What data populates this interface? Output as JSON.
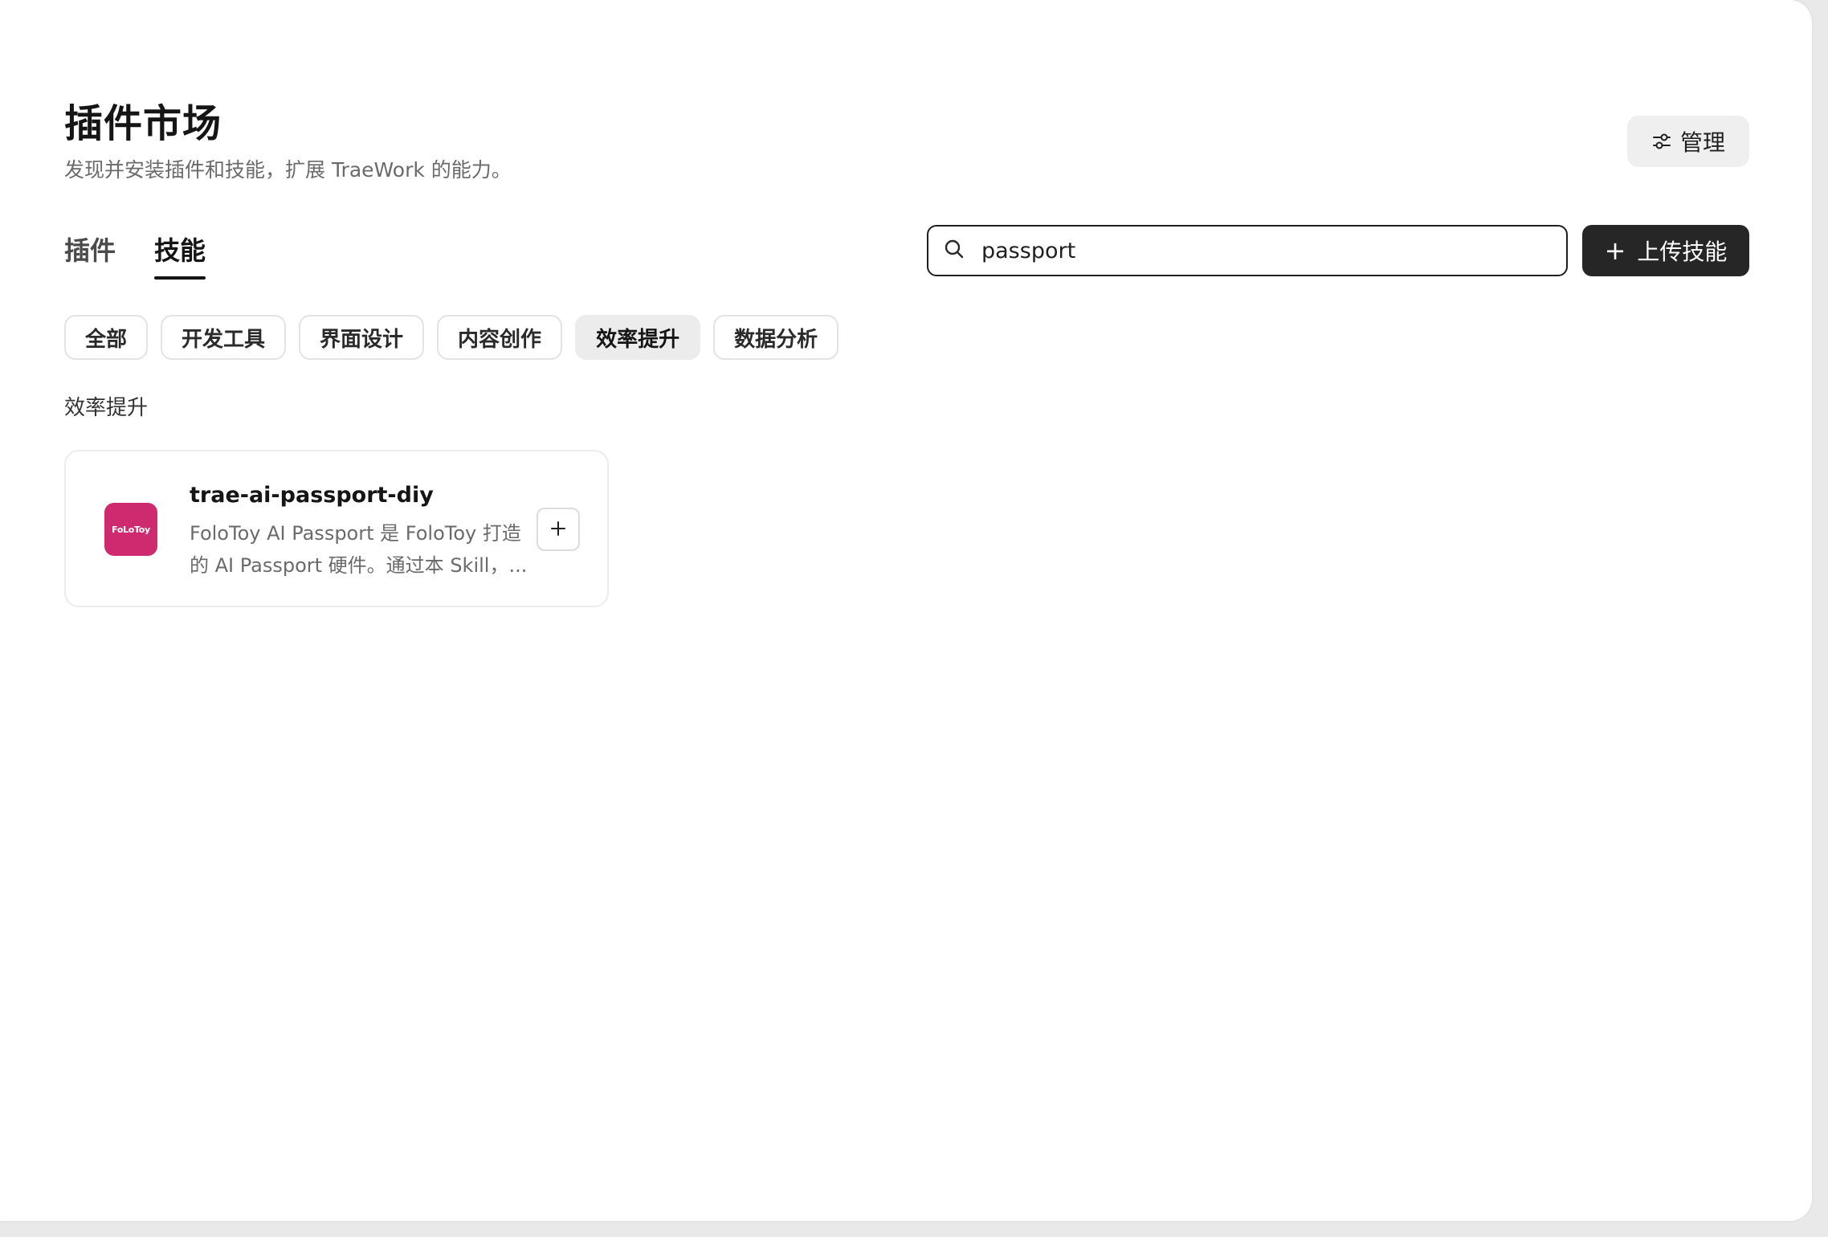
{
  "header": {
    "title": "插件市场",
    "subtitle": "发现并安装插件和技能，扩展 TraeWork 的能力。",
    "manage_label": "管理"
  },
  "main_tabs": [
    {
      "label": "插件",
      "active": false
    },
    {
      "label": "技能",
      "active": true
    }
  ],
  "search": {
    "value": "passport",
    "placeholder": ""
  },
  "upload": {
    "label": "上传技能"
  },
  "categories": [
    {
      "label": "全部",
      "active": false
    },
    {
      "label": "开发工具",
      "active": false
    },
    {
      "label": "界面设计",
      "active": false
    },
    {
      "label": "内容创作",
      "active": false
    },
    {
      "label": "效率提升",
      "active": true
    },
    {
      "label": "数据分析",
      "active": false
    }
  ],
  "section": {
    "label": "效率提升"
  },
  "skills": [
    {
      "name": "trae-ai-passport-diy",
      "logo_text": "FoLoToy",
      "logo_color": "#cd2a6f",
      "desc_line1": "FoloToy AI Passport 是 FoloToy 打造",
      "desc_line2": "的 AI Passport 硬件。通过本 Skill，..."
    }
  ],
  "colors": {
    "accent_dark": "#262626",
    "chip_active_bg": "#ececec",
    "logo_bg": "#cd2a6f"
  },
  "icons": {
    "manage": "sliders-icon",
    "search": "search-icon",
    "upload": "plus-icon",
    "add": "plus-icon"
  }
}
